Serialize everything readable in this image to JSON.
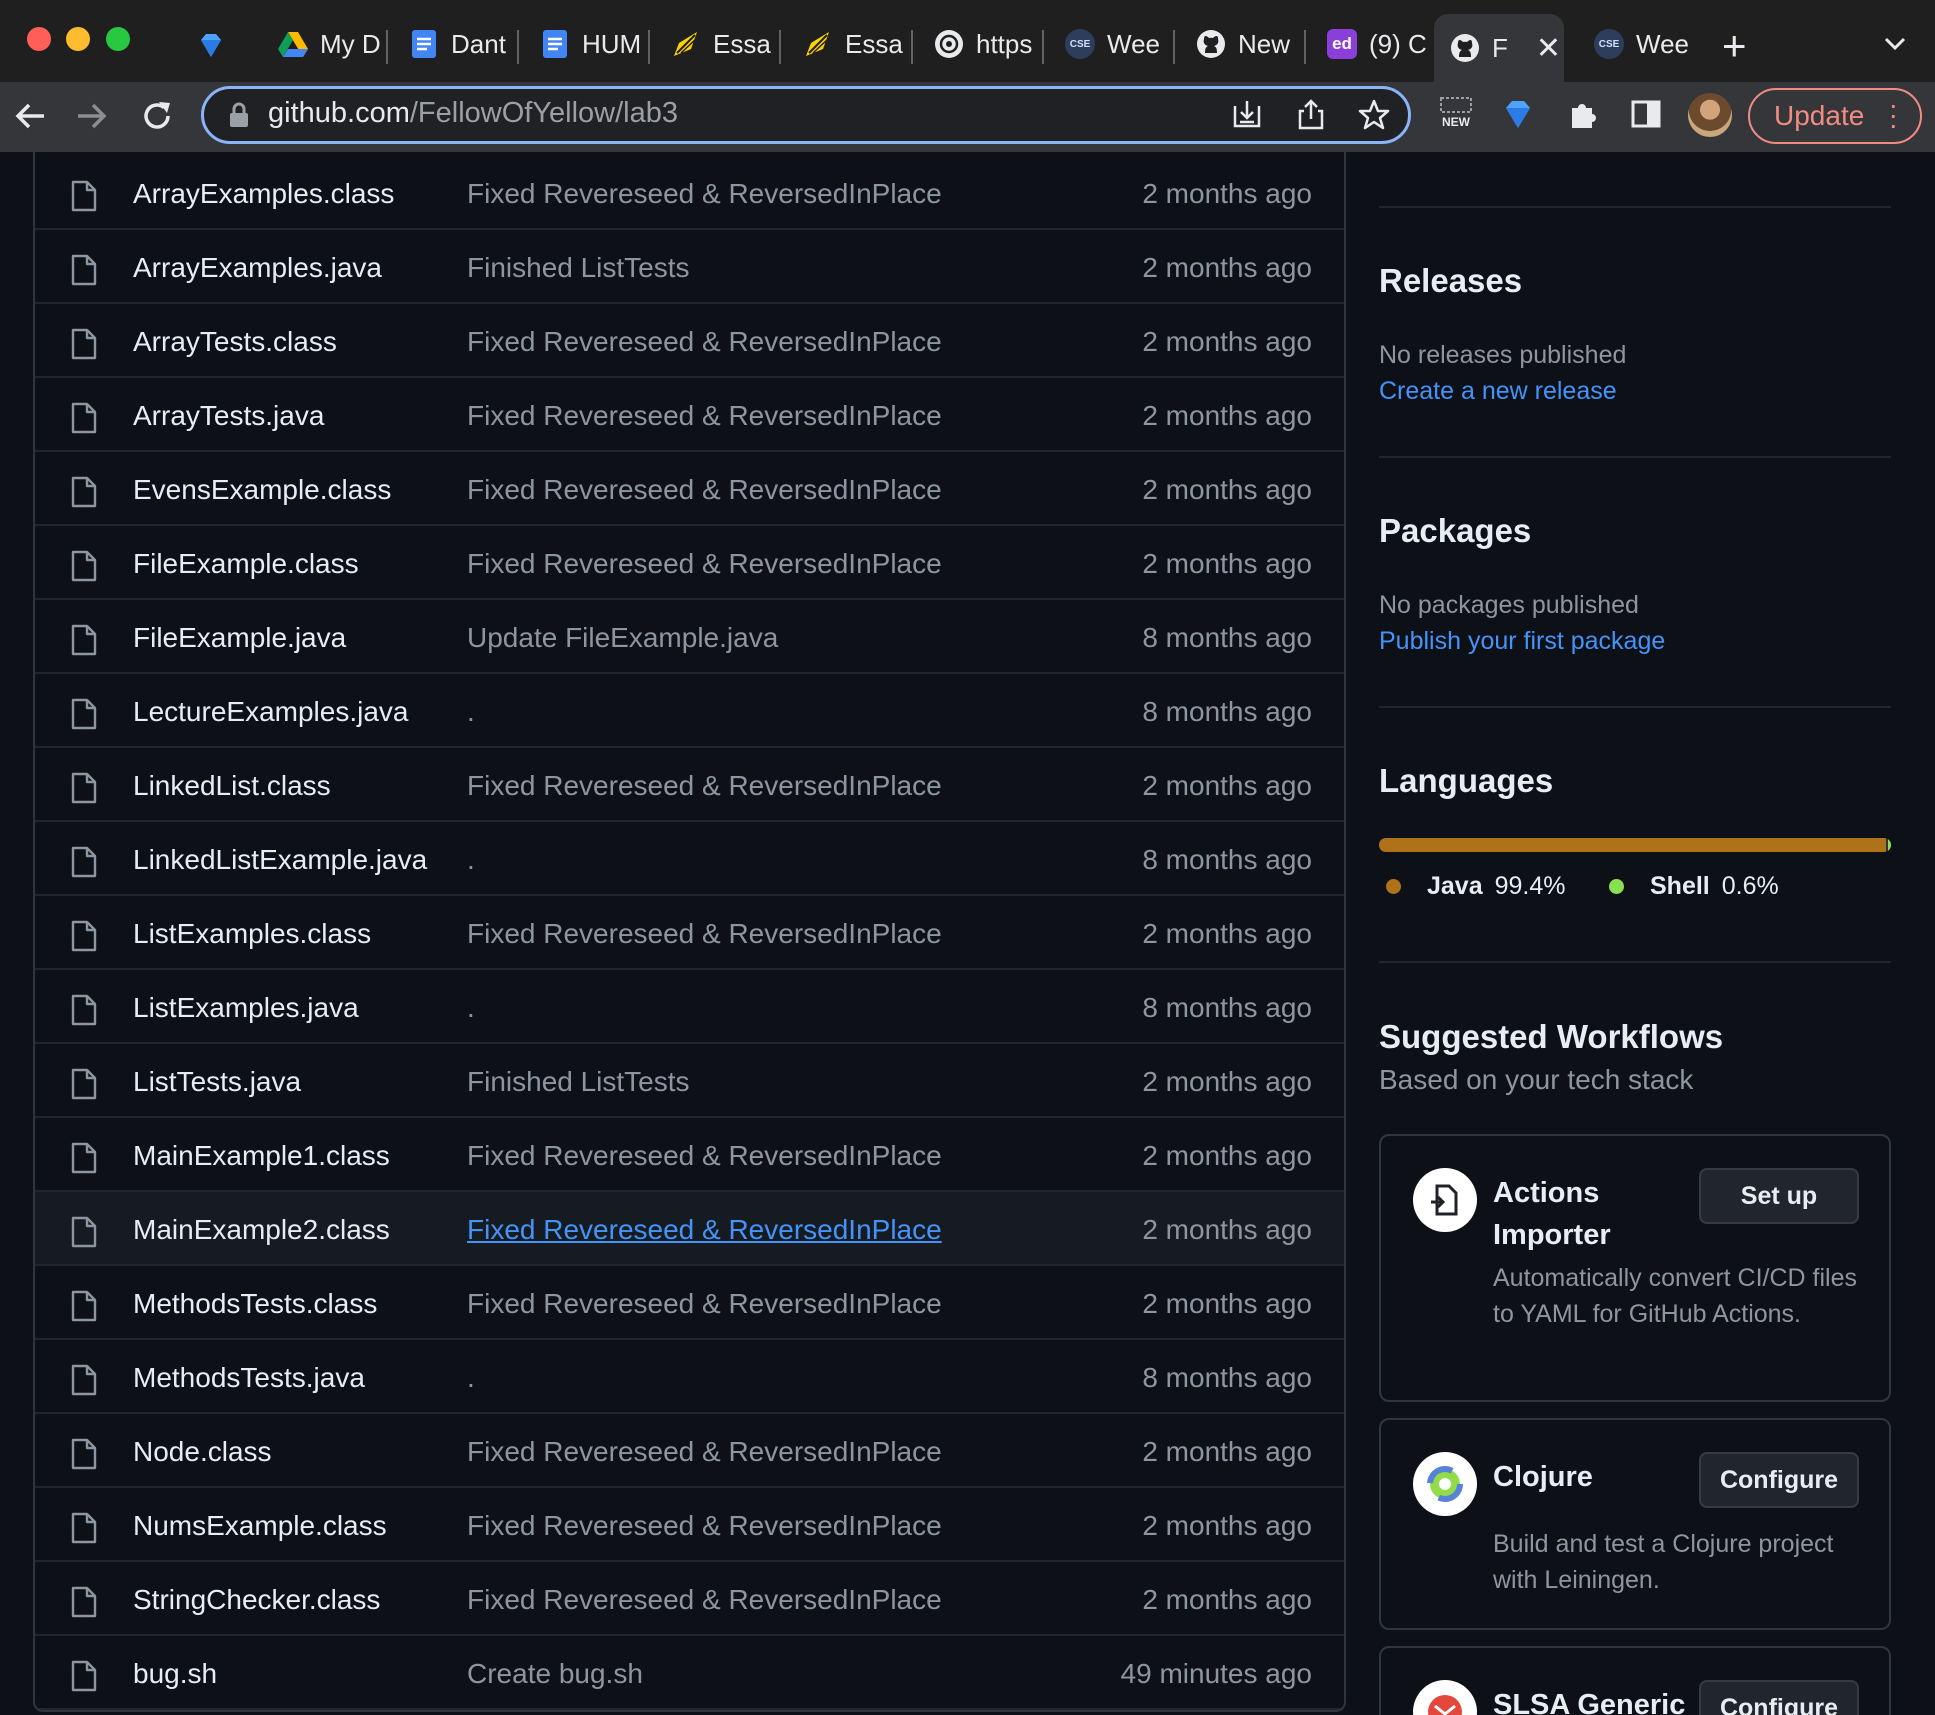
{
  "browser": {
    "tabs": [
      {
        "label": "My D",
        "icon": "google-drive-icon"
      },
      {
        "label": "Dant",
        "icon": "google-docs-icon"
      },
      {
        "label": "HUM",
        "icon": "google-docs-icon"
      },
      {
        "label": "Essa",
        "icon": "pen-icon"
      },
      {
        "label": "Essa",
        "icon": "pen-icon"
      },
      {
        "label": "https",
        "icon": "openai-icon"
      },
      {
        "label": "Wee",
        "icon": "cse-icon"
      },
      {
        "label": "New",
        "icon": "github-icon"
      },
      {
        "label": "(9) C",
        "icon": "ed-icon"
      },
      {
        "label": "F",
        "icon": "github-icon",
        "active": true
      },
      {
        "label": "Wee",
        "icon": "cse-icon"
      }
    ],
    "fav_texts": {
      "cse": "CSE",
      "ed": "ed"
    },
    "url_host": "github.com",
    "url_path": "/FellowOfYellow/lab3",
    "update_label": "Update",
    "ext_new_label": "NEW",
    "colors": {
      "accent": "#8ab4f8",
      "update": "#f28b82"
    }
  },
  "files": [
    {
      "name": "ArrayExamples.class",
      "message": "Fixed Revereseed & ReversedInPlace",
      "date": "2 months ago"
    },
    {
      "name": "ArrayExamples.java",
      "message": "Finished ListTests",
      "date": "2 months ago"
    },
    {
      "name": "ArrayTests.class",
      "message": "Fixed Revereseed & ReversedInPlace",
      "date": "2 months ago"
    },
    {
      "name": "ArrayTests.java",
      "message": "Fixed Revereseed & ReversedInPlace",
      "date": "2 months ago"
    },
    {
      "name": "EvensExample.class",
      "message": "Fixed Revereseed & ReversedInPlace",
      "date": "2 months ago"
    },
    {
      "name": "FileExample.class",
      "message": "Fixed Revereseed & ReversedInPlace",
      "date": "2 months ago"
    },
    {
      "name": "FileExample.java",
      "message": "Update FileExample.java",
      "date": "8 months ago"
    },
    {
      "name": "LectureExamples.java",
      "message": ".",
      "date": "8 months ago"
    },
    {
      "name": "LinkedList.class",
      "message": "Fixed Revereseed & ReversedInPlace",
      "date": "2 months ago"
    },
    {
      "name": "LinkedListExample.java",
      "message": ".",
      "date": "8 months ago"
    },
    {
      "name": "ListExamples.class",
      "message": "Fixed Revereseed & ReversedInPlace",
      "date": "2 months ago"
    },
    {
      "name": "ListExamples.java",
      "message": ".",
      "date": "8 months ago"
    },
    {
      "name": "ListTests.java",
      "message": "Finished ListTests",
      "date": "2 months ago"
    },
    {
      "name": "MainExample1.class",
      "message": "Fixed Revereseed & ReversedInPlace",
      "date": "2 months ago"
    },
    {
      "name": "MainExample2.class",
      "message": "Fixed Revereseed & ReversedInPlace",
      "date": "2 months ago",
      "hovered": true
    },
    {
      "name": "MethodsTests.class",
      "message": "Fixed Revereseed & ReversedInPlace",
      "date": "2 months ago"
    },
    {
      "name": "MethodsTests.java",
      "message": ".",
      "date": "8 months ago"
    },
    {
      "name": "Node.class",
      "message": "Fixed Revereseed & ReversedInPlace",
      "date": "2 months ago"
    },
    {
      "name": "NumsExample.class",
      "message": "Fixed Revereseed & ReversedInPlace",
      "date": "2 months ago"
    },
    {
      "name": "StringChecker.class",
      "message": "Fixed Revereseed & ReversedInPlace",
      "date": "2 months ago"
    },
    {
      "name": "bug.sh",
      "message": "Create bug.sh",
      "date": "49 minutes ago"
    }
  ],
  "sidebar": {
    "releases": {
      "title": "Releases",
      "empty": "No releases published",
      "link": "Create a new release"
    },
    "packages": {
      "title": "Packages",
      "empty": "No packages published",
      "link": "Publish your first package"
    },
    "languages": {
      "title": "Languages",
      "items": [
        {
          "name": "Java",
          "percent": "99.4%",
          "value": 99.4,
          "color": "#b07219"
        },
        {
          "name": "Shell",
          "percent": "0.6%",
          "value": 0.6,
          "color": "#89e051"
        }
      ]
    },
    "workflows": {
      "title": "Suggested Workflows",
      "subtitle": "Based on your tech stack",
      "cards": [
        {
          "title": "Actions Importer",
          "button": "Set up",
          "description": "Automatically convert CI/CD files to YAML for GitHub Actions.",
          "icon": "actions-importer-icon"
        },
        {
          "title": "Clojure",
          "button": "Configure",
          "description": "Build and test a Clojure project with Leiningen.",
          "icon": "clojure-icon"
        },
        {
          "title": "SLSA Generic",
          "button": "Configure",
          "description": "",
          "icon": "slsa-icon"
        }
      ]
    }
  }
}
